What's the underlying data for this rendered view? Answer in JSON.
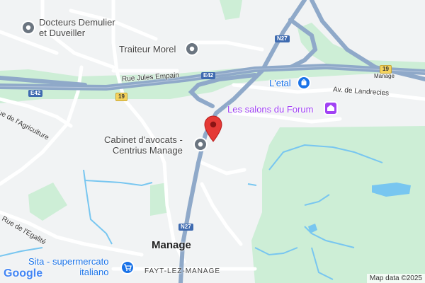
{
  "map": {
    "provider_logo": "Google",
    "attribution": "Map data ©2025",
    "marker": {
      "name": "location-pin",
      "color": "#e53935"
    },
    "colors": {
      "background": "#f1f3f4",
      "greenery": "#cdeed6",
      "motorway": "#8fa9c9",
      "road": "#ffffff",
      "water": "#78c6f0",
      "poi_grey": "#6b7580",
      "poi_blue": "#1a73e8",
      "poi_purple": "#a142f4"
    },
    "pois": [
      {
        "id": "docteurs",
        "line1": "Docteurs Demulier",
        "line2": "et Duveiller",
        "icon": "medical-icon"
      },
      {
        "id": "traiteur",
        "line1": "Traiteur Morel",
        "line2": "",
        "icon": "catering-icon"
      },
      {
        "id": "letal",
        "line1": "L'etal",
        "line2": "",
        "icon": "shopping-bag-icon"
      },
      {
        "id": "salons",
        "line1": "Les salons du Forum",
        "line2": "",
        "icon": "event-venue-icon"
      },
      {
        "id": "cabinet",
        "line1": "Cabinet d'avocats -",
        "line2": "Centrius Manage",
        "icon": "office-icon"
      },
      {
        "id": "sita",
        "line1": "Sita - supermercato",
        "line2": "italiano",
        "icon": "shopping-cart-icon"
      }
    ],
    "streets": {
      "jules_empain": "Rue Jules Empain",
      "agriculture": "Rue de l'Agriculture",
      "landrecies": "Av. de Landrecies",
      "egalite": "Rue de l'Egalité"
    },
    "places": {
      "manage": "Manage",
      "fayt": "FAYT-LEZ-MANAGE"
    },
    "shields": {
      "n27_top": "N27",
      "n27_bottom": "N27",
      "e42_left": "E42",
      "e42_mid": "E42",
      "r19_left": "19",
      "r19_right": "19",
      "manage_sign": "Manage"
    }
  }
}
